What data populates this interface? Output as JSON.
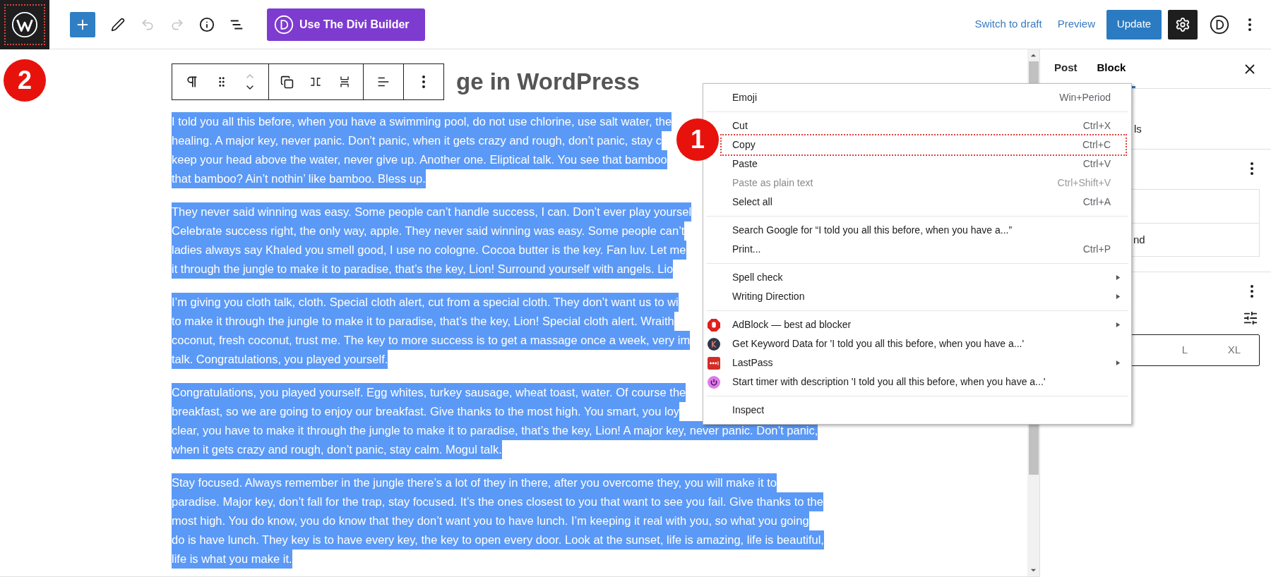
{
  "top_bar": {
    "logo": {
      "outlined": true,
      "marker": "2"
    },
    "undo_disabled": true,
    "redo_disabled": true,
    "divi_button": "Use The Divi Builder",
    "switch_to_draft": "Switch to draft",
    "preview": "Preview",
    "update": "Update",
    "settings_active": true
  },
  "editor": {
    "title": "ge in WordPress",
    "paragraphs": [
      [
        "I told you all this before, when you have a swimming pool, do not use chlorine, use salt water, the",
        "healing. A major key, never panic. Don’t panic, when it gets crazy and rough, don’t panic, stay c",
        "keep your head above the water, never give up. Another one. Eliptical talk. You see that bamboo",
        "that bamboo? Ain’t nothin’ like bamboo. Bless up."
      ],
      [
        "They never said winning was easy. Some people can’t handle success, I can. Don’t ever play yoursel",
        "Celebrate success right, the only way, apple. They never said winning was easy. Some people can’t",
        "ladies always say Khaled you smell good, I use no cologne. Cocoa butter is the key. Fan luv. Let me",
        "it through the jungle to make it to paradise, that’s the key, Lion! Surround yourself with angels. Lio"
      ],
      [
        "I’m giving you cloth talk, cloth. Special cloth alert, cut from a special cloth. They don’t want us to wi",
        "to make it through the jungle to make it to paradise, that’s the key, Lion! Special cloth alert. Wraith",
        "coconut, fresh coconut, trust me. The key to more success is to get a massage once a week, very im",
        "talk. Congratulations, you played yourself."
      ],
      [
        "Congratulations, you played yourself. Egg whites, turkey sausage, wheat toast, water. Of course the",
        "breakfast, so we are going to enjoy our breakfast. Give thanks to the most high. You smart, you loy",
        "clear, you have to make it through the jungle to make it to paradise, that’s the key, Lion! A major key, never panic. Don’t panic,",
        "when it gets crazy and rough, don’t panic, stay calm. Mogul talk."
      ],
      [
        "Stay focused. Always remember in the jungle there’s a lot of they in there, after you overcome they, you will make it to",
        "paradise. Major key, don’t fall for the trap, stay focused. It’s the ones closest to you that want to see you fail. Give thanks to the",
        "most high. You do know, you do know that they don’t want you to have lunch. I’m keeping it real with you, so what you going",
        "do is have lunch. They key is to have every key, the key to open every door. Look at the sunset, life is amazing, life is beautiful,",
        "life is what you make it."
      ]
    ]
  },
  "context_menu": {
    "groups": [
      [
        {
          "label": "Emoji",
          "shortcut": "Win+Period",
          "disabled": false,
          "submenu": false,
          "outlined": false
        }
      ],
      [
        {
          "label": "Cut",
          "shortcut": "Ctrl+X",
          "disabled": false,
          "submenu": false,
          "outlined": false
        },
        {
          "label": "Copy",
          "shortcut": "Ctrl+C",
          "disabled": false,
          "submenu": false,
          "outlined": true,
          "marker": "1"
        },
        {
          "label": "Paste",
          "shortcut": "Ctrl+V",
          "disabled": false,
          "submenu": false,
          "outlined": false
        },
        {
          "label": "Paste as plain text",
          "shortcut": "Ctrl+Shift+V",
          "disabled": true,
          "submenu": false,
          "outlined": false
        },
        {
          "label": "Select all",
          "shortcut": "Ctrl+A",
          "disabled": false,
          "submenu": false,
          "outlined": false
        }
      ],
      [
        {
          "label": "Search Google for “I told you all this before, when you have a...”",
          "disabled": false,
          "submenu": false,
          "outlined": false
        },
        {
          "label": "Print...",
          "shortcut": "Ctrl+P",
          "disabled": false,
          "submenu": false,
          "outlined": false
        }
      ],
      [
        {
          "label": "Spell check",
          "disabled": false,
          "submenu": true,
          "outlined": false
        },
        {
          "label": "Writing Direction",
          "disabled": false,
          "submenu": true,
          "outlined": false
        }
      ],
      [
        {
          "label": "AdBlock — best ad blocker",
          "disabled": false,
          "submenu": true,
          "outlined": false,
          "color": "#e0201c"
        },
        {
          "label": "Get Keyword Data for 'I told you all this before, when you have a...'",
          "disabled": false,
          "submenu": false,
          "outlined": false,
          "color": "#2d3748"
        },
        {
          "label": "LastPass",
          "disabled": false,
          "submenu": true,
          "outlined": false,
          "color": "#d32d27"
        },
        {
          "label": "Start timer with description 'I told you all this before, when you have a...'",
          "disabled": false,
          "submenu": false,
          "outlined": false,
          "color": "#e07ae8"
        }
      ],
      [
        {
          "label": "Inspect",
          "disabled": false,
          "submenu": false,
          "outlined": false
        }
      ]
    ]
  },
  "sidebar": {
    "tabs": [
      {
        "label": "Post",
        "selected": false
      },
      {
        "label": "Block",
        "selected": true
      }
    ],
    "fragment_1": "ls",
    "fragment_2": "nd",
    "sizes": [
      "L",
      "XL"
    ]
  }
}
